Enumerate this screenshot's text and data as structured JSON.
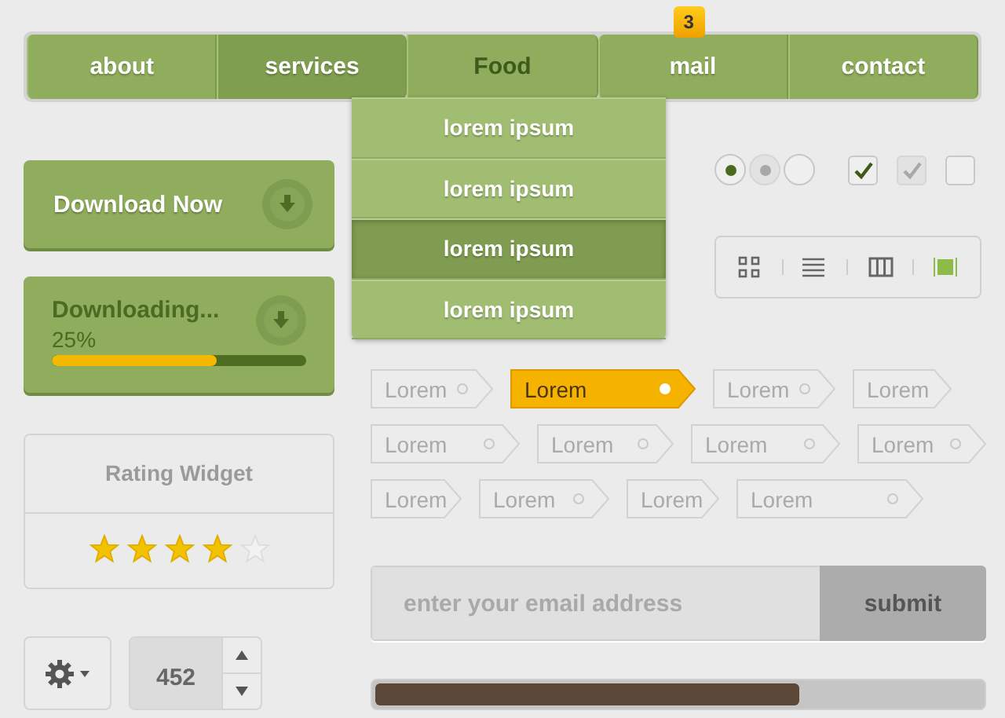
{
  "nav": {
    "items": [
      {
        "label": "about",
        "selected": false,
        "hovered": false
      },
      {
        "label": "services",
        "selected": false,
        "hovered": true
      },
      {
        "label": "Food",
        "selected": true,
        "hovered": false
      },
      {
        "label": "mail",
        "selected": false,
        "hovered": false,
        "badge": "3"
      },
      {
        "label": "contact",
        "selected": false,
        "hovered": false
      }
    ]
  },
  "dropdown": {
    "items": [
      {
        "label": "lorem ipsum",
        "selected": false
      },
      {
        "label": "lorem ipsum",
        "selected": false
      },
      {
        "label": "lorem ipsum",
        "selected": true
      },
      {
        "label": "lorem ipsum",
        "selected": false
      }
    ]
  },
  "download_button": {
    "label": "Download Now"
  },
  "download_progress": {
    "label": "Downloading...",
    "percent": "25%",
    "level": 0.65
  },
  "rating": {
    "title": "Rating Widget",
    "stars": 4
  },
  "spinner": {
    "value": "452"
  },
  "radios": [
    {
      "checked": true,
      "disabled": false
    },
    {
      "checked": true,
      "disabled": true
    },
    {
      "checked": false,
      "disabled": false
    }
  ],
  "checkboxes": [
    {
      "checked": true,
      "disabled": false
    },
    {
      "checked": true,
      "disabled": true
    },
    {
      "checked": false,
      "disabled": false
    }
  ],
  "view_switcher": [
    {
      "kind": "grid",
      "selected": false
    },
    {
      "kind": "list",
      "selected": false
    },
    {
      "kind": "columns",
      "selected": false
    },
    {
      "kind": "slides",
      "selected": true
    }
  ],
  "tags": [
    {
      "label": "Lorem",
      "selected": false
    },
    {
      "label": "Lorem",
      "selected": true
    },
    {
      "label": "Lorem",
      "selected": false
    },
    {
      "label": "Lorem",
      "selected": false
    },
    {
      "label": "Lorem",
      "selected": false
    },
    {
      "label": "Lorem",
      "selected": false
    },
    {
      "label": "Lorem",
      "selected": false
    },
    {
      "label": "Lorem",
      "selected": false
    },
    {
      "label": "Lorem",
      "selected": false
    },
    {
      "label": "Lorem",
      "selected": false
    },
    {
      "label": "Lorem",
      "selected": false
    },
    {
      "label": "Lorem",
      "selected": false
    }
  ],
  "newsletter": {
    "placeholder": "enter your email address",
    "button": "submit"
  },
  "progress": {
    "level": 0.7
  }
}
